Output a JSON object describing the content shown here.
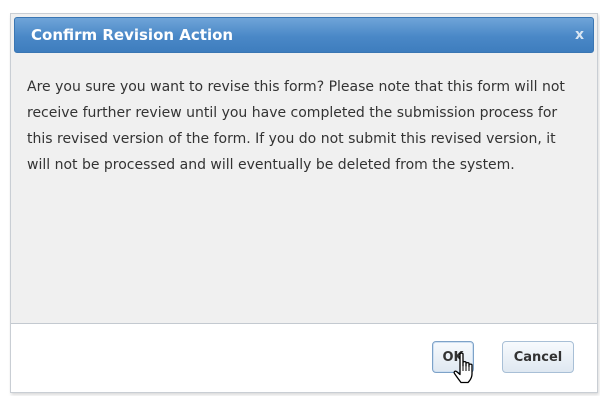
{
  "dialog": {
    "title": "Confirm Revision Action",
    "close_glyph": "x",
    "message": "Are you sure you want to revise this form? Please note that this form will not receive further review until you have completed the submission process for this revised version of the form. If you do not submit this revised version, it will not be processed and will eventually be deleted from the system.",
    "buttons": {
      "ok_label": "OK",
      "cancel_label": "Cancel"
    }
  },
  "cursor_icon": "hand-pointer-icon",
  "colors": {
    "titlebar": "#4a88c7",
    "title_text": "#ffffff",
    "body_background": "#f0f0f0",
    "button_bar_background": "#ffffff",
    "text": "#333333"
  }
}
